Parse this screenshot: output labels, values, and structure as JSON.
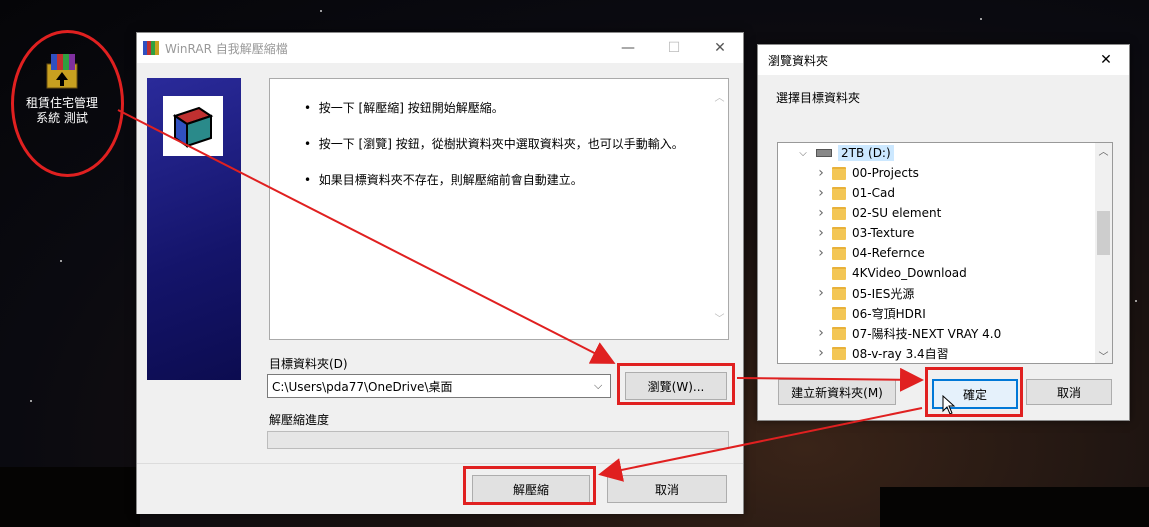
{
  "desktop": {
    "icon_label": "租賃住宅管理系統 測試"
  },
  "winrar": {
    "title": "WinRAR 自我解壓縮檔",
    "instructions": [
      "按一下 [解壓縮] 按鈕開始解壓縮。",
      "按一下 [瀏覽] 按鈕，從樹狀資料夾中選取資料夾，也可以手動輸入。",
      "如果目標資料夾不存在，則解壓縮前會自動建立。"
    ],
    "dest_label": "目標資料夾(D)",
    "dest_value": "C:\\Users\\pda77\\OneDrive\\桌面",
    "browse_label": "瀏覽(W)...",
    "progress_label": "解壓縮進度",
    "progress": 0,
    "extract_label": "解壓縮",
    "cancel_label": "取消"
  },
  "browse": {
    "title": "瀏覽資料夾",
    "prompt": "選擇目標資料夾",
    "drive": "2TB (D:)",
    "folders": [
      {
        "name": "00-Projects",
        "expand": true
      },
      {
        "name": "01-Cad",
        "expand": true
      },
      {
        "name": "02-SU element",
        "expand": true
      },
      {
        "name": "03-Texture",
        "expand": true
      },
      {
        "name": "04-Refernce",
        "expand": true
      },
      {
        "name": "4KVideo_Download",
        "expand": false
      },
      {
        "name": "05-IES光源",
        "expand": true
      },
      {
        "name": "06-穹頂HDRI",
        "expand": false
      },
      {
        "name": "07-陽科技-NEXT VRAY 4.0",
        "expand": true
      },
      {
        "name": "08-v-ray 3.4自習",
        "expand": true
      }
    ],
    "new_folder_label": "建立新資料夾(M)",
    "ok_label": "確定",
    "cancel_label": "取消"
  },
  "colors": {
    "highlight": "#e02020",
    "dialog_bg": "#f0f0f0",
    "banner": "#1a1a7a"
  }
}
